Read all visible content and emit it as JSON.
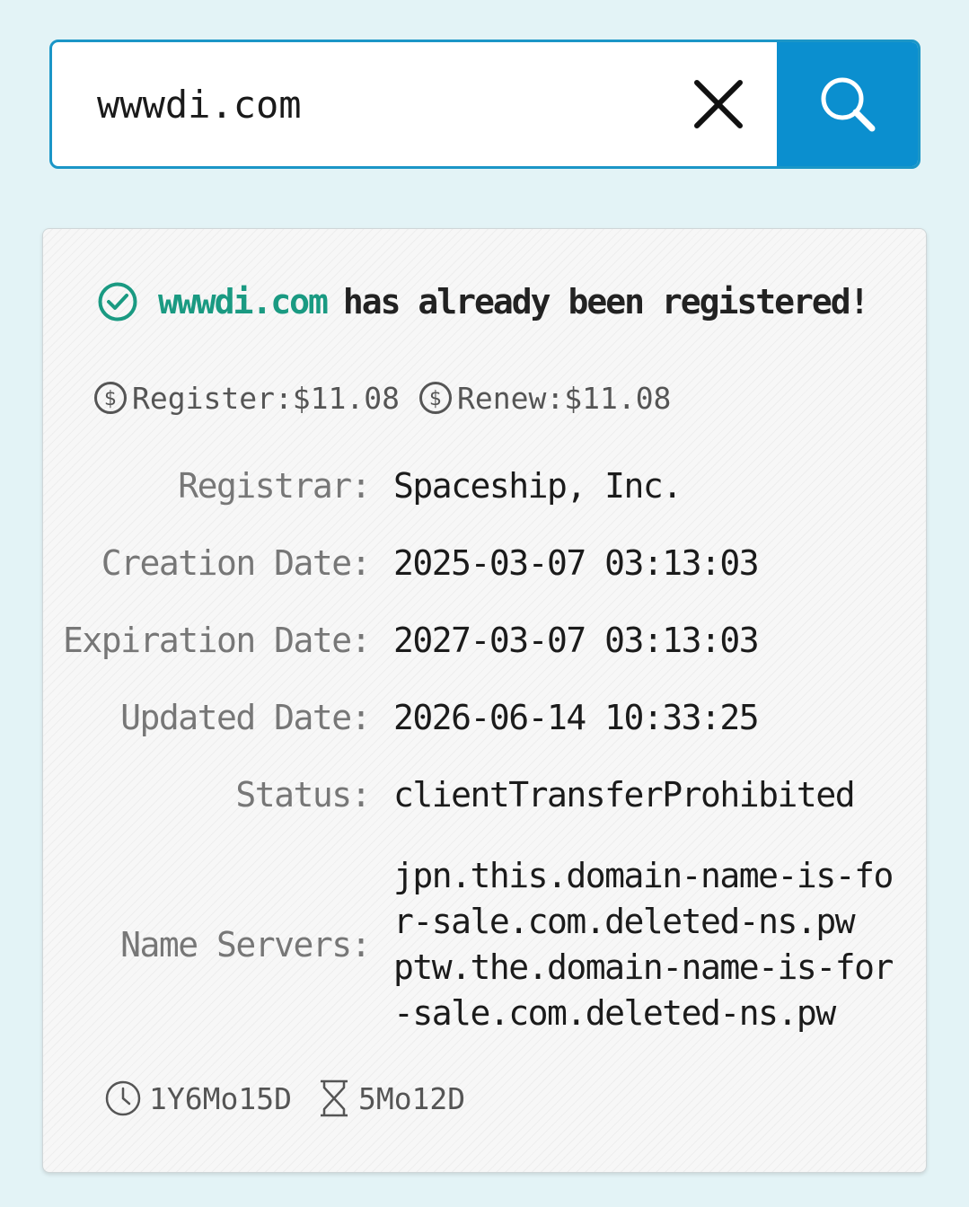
{
  "search": {
    "value": "wwwdi.com"
  },
  "result": {
    "domain": "wwwdi.com",
    "message": "has already been registered!"
  },
  "prices": {
    "register": "Register:$11.08",
    "renew": "Renew:$11.08"
  },
  "details": {
    "registrar_label": "Registrar:",
    "registrar_value": "Spaceship, Inc.",
    "creation_label": "Creation Date:",
    "creation_value": "2025-03-07 03:13:03",
    "expiration_label": "Expiration Date:",
    "expiration_value": "2027-03-07 03:13:03",
    "updated_label": "Updated Date:",
    "updated_value": "2026-06-14 10:33:25",
    "status_label": "Status:",
    "status_value": "clientTransferProhibited",
    "nameservers_label": "Name Servers:",
    "nameservers_lines": [
      "jpn.this.domain-name-is-fo",
      "r-sale.com.deleted-ns.pw",
      "ptw.the.domain-name-is-for",
      "-sale.com.deleted-ns.pw"
    ]
  },
  "footer": {
    "age": "1Y6Mo15D",
    "remaining": "5Mo12D"
  },
  "icons": {
    "status": "check-circle-icon",
    "price": "dollar-circle-icon",
    "age": "clock-icon",
    "remaining": "hourglass-icon",
    "clear": "close-icon",
    "search": "search-icon"
  },
  "colors": {
    "accent": "#0b8fcf",
    "border": "#1b96c7",
    "success": "#1a9a82",
    "background": "#e3f3f6"
  }
}
